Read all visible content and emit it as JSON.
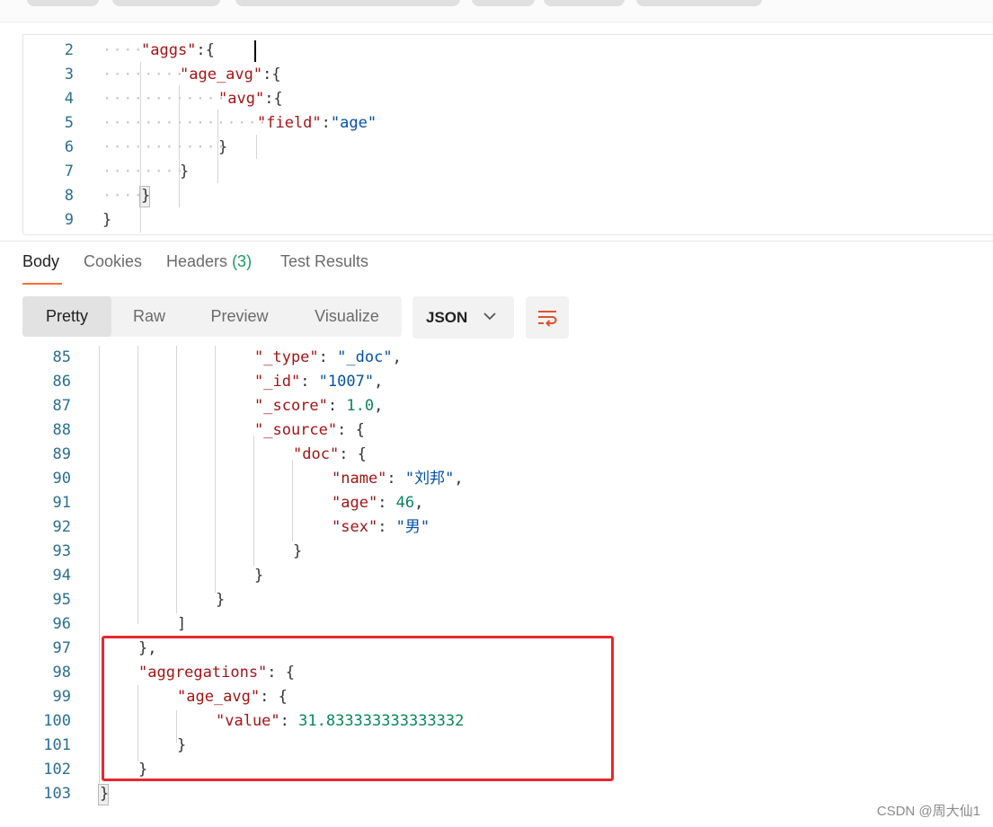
{
  "request_editor": {
    "lines": [
      {
        "n": "2",
        "indent": 1,
        "key": "\"aggs\"",
        "after": ":{",
        "cursor": true
      },
      {
        "n": "3",
        "indent": 2,
        "key": "\"age_avg\"",
        "after": ":{"
      },
      {
        "n": "4",
        "indent": 3,
        "key": "\"avg\"",
        "after": ":{"
      },
      {
        "n": "5",
        "indent": 4,
        "key": "\"field\"",
        "after": ":",
        "str": "\"age\""
      },
      {
        "n": "6",
        "indent": 3,
        "punct": "}"
      },
      {
        "n": "7",
        "indent": 2,
        "punct": "}"
      },
      {
        "n": "8",
        "indent": 1,
        "punct": "}",
        "bracket_match": true
      },
      {
        "n": "9",
        "indent": 0,
        "punct": "}"
      }
    ]
  },
  "response_tabs": [
    {
      "label": "Body",
      "active": true
    },
    {
      "label": "Cookies"
    },
    {
      "label": "Headers",
      "count": "(3)"
    },
    {
      "label": "Test Results"
    }
  ],
  "view_modes": [
    {
      "label": "Pretty",
      "active": true
    },
    {
      "label": "Raw"
    },
    {
      "label": "Preview"
    },
    {
      "label": "Visualize"
    }
  ],
  "format": {
    "selected": "JSON",
    "icon": "chevron-down-icon"
  },
  "wrap_icon": "wrap-lines-icon",
  "accent_color": "#ff6c37",
  "highlight_color": "#e8272e",
  "response_body": {
    "lines": [
      {
        "n": "85",
        "indent": 4,
        "key": "\"_type\"",
        "after": ": ",
        "str": "\"_doc\"",
        "tail": ","
      },
      {
        "n": "86",
        "indent": 4,
        "key": "\"_id\"",
        "after": ": ",
        "str": "\"1007\"",
        "tail": ","
      },
      {
        "n": "87",
        "indent": 4,
        "key": "\"_score\"",
        "after": ": ",
        "num": "1.0",
        "tail": ","
      },
      {
        "n": "88",
        "indent": 4,
        "key": "\"_source\"",
        "after": ": {"
      },
      {
        "n": "89",
        "indent": 5,
        "key": "\"doc\"",
        "after": ": {"
      },
      {
        "n": "90",
        "indent": 6,
        "key": "\"name\"",
        "after": ": ",
        "str": "\"刘邦\"",
        "tail": ","
      },
      {
        "n": "91",
        "indent": 6,
        "key": "\"age\"",
        "after": ": ",
        "num": "46",
        "tail": ","
      },
      {
        "n": "92",
        "indent": 6,
        "key": "\"sex\"",
        "after": ": ",
        "str": "\"男\""
      },
      {
        "n": "93",
        "indent": 5,
        "punct": "}"
      },
      {
        "n": "94",
        "indent": 4,
        "punct": "}"
      },
      {
        "n": "95",
        "indent": 3,
        "punct": "}"
      },
      {
        "n": "96",
        "indent": 2,
        "punct": "]"
      },
      {
        "n": "97",
        "indent": 1,
        "punct": "},"
      },
      {
        "n": "98",
        "indent": 1,
        "key": "\"aggregations\"",
        "after": ": {"
      },
      {
        "n": "99",
        "indent": 2,
        "key": "\"age_avg\"",
        "after": ": {"
      },
      {
        "n": "100",
        "indent": 3,
        "key": "\"value\"",
        "after": ": ",
        "num": "31.833333333333332"
      },
      {
        "n": "101",
        "indent": 2,
        "punct": "}"
      },
      {
        "n": "102",
        "indent": 1,
        "punct": "}"
      },
      {
        "n": "103",
        "indent": 0,
        "punct": "}",
        "bracket_match": true
      }
    ]
  },
  "watermark": "CSDN @周大仙1"
}
